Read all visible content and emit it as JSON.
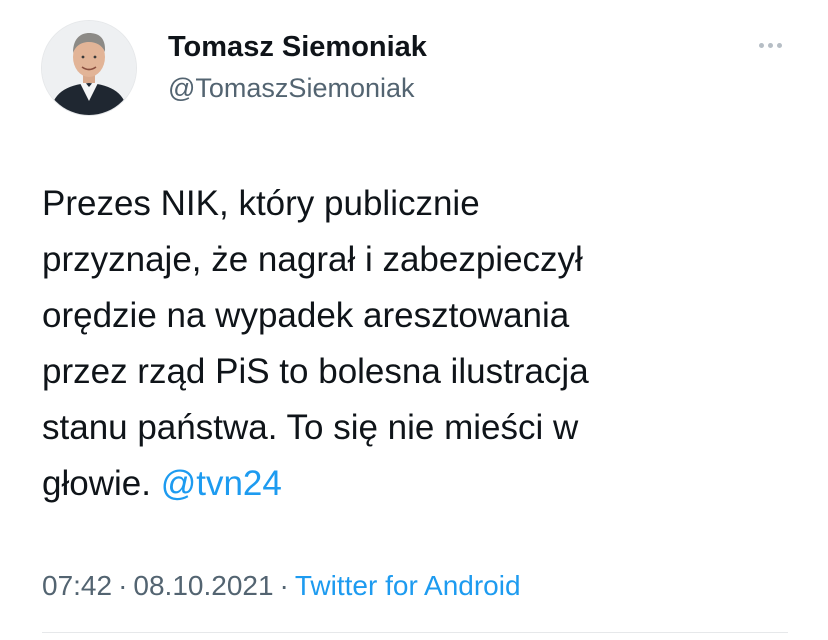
{
  "author": {
    "display_name": "Tomasz Siemoniak",
    "handle": "@TomaszSiemoniak",
    "avatar_icon": "profile-photo"
  },
  "tweet": {
    "lines": [
      "Prezes NIK, który publicznie",
      "przyznaje, że nagrał i zabezpieczył",
      "orędzie na wypadek aresztowania",
      "przez rząd PiS to bolesna ilustracja",
      "stanu państwa. To się nie mieści w"
    ],
    "last_line_text": "głowie.",
    "mention": "@tvn24"
  },
  "meta": {
    "time": "07:42",
    "separator": "·",
    "date": "08.10.2021",
    "source": "Twitter for Android"
  },
  "icons": {
    "more": "more-horizontal-icon"
  },
  "colors": {
    "text": "#0f1419",
    "secondary": "#536471",
    "accent": "#1d9bf0",
    "divider": "#e6e8ea"
  }
}
